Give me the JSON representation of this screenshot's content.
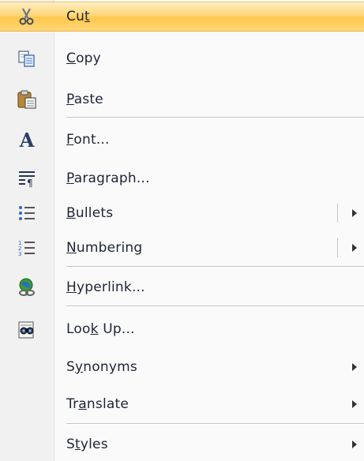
{
  "menu": {
    "items": [
      {
        "key": "cut",
        "pre": "Cu",
        "acc": "t",
        "post": "",
        "icon": "scissors-icon"
      },
      {
        "key": "copy",
        "pre": "",
        "acc": "C",
        "post": "opy",
        "icon": "copy-icon"
      },
      {
        "key": "paste",
        "pre": "",
        "acc": "P",
        "post": "aste",
        "icon": "clipboard-icon"
      },
      {
        "key": "font",
        "pre": "",
        "acc": "F",
        "post": "ont...",
        "icon": "font-a-icon"
      },
      {
        "key": "paragraph",
        "pre": "",
        "acc": "P",
        "post": "aragraph...",
        "icon": "paragraph-icon"
      },
      {
        "key": "bullets",
        "pre": "",
        "acc": "B",
        "post": "ullets",
        "icon": "bullets-icon"
      },
      {
        "key": "numbering",
        "pre": "",
        "acc": "N",
        "post": "umbering",
        "icon": "numbering-icon"
      },
      {
        "key": "hyperlink",
        "pre": "",
        "acc": "H",
        "post": "yperlink...",
        "icon": "hyperlink-globe-icon"
      },
      {
        "key": "lookup",
        "pre": "Loo",
        "acc": "k",
        "post": " Up...",
        "icon": "research-binoculars-icon"
      },
      {
        "key": "synonyms",
        "pre": "S",
        "acc": "y",
        "post": "nonyms",
        "icon": ""
      },
      {
        "key": "translate",
        "pre": "Tr",
        "acc": "a",
        "post": "nslate",
        "icon": ""
      },
      {
        "key": "styles",
        "pre": "S",
        "acc": "t",
        "post": "yles",
        "icon": ""
      }
    ],
    "colors": {
      "highlight": "#ffd678",
      "gutter": "#f1f1f1",
      "text": "#1e2436"
    }
  }
}
